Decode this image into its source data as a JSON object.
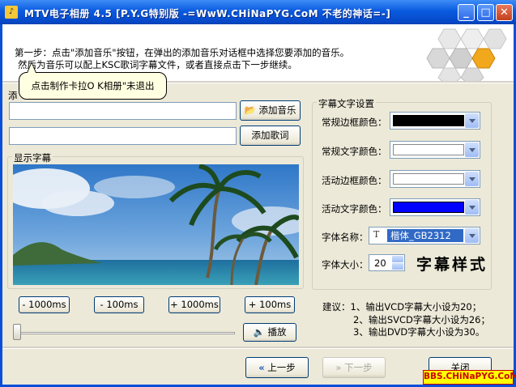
{
  "window": {
    "title": "MTV电子相册 4.5 [P.Y.G特别版 -=WwW.CHiNaPYG.CoM 不老的神话=-]",
    "title_icon": "app-icon",
    "controls": [
      "minimize-icon",
      "maximize-icon",
      "close-icon"
    ]
  },
  "header": {
    "step_line1": "第一步：点击\"添加音乐\"按钮，在弹出的添加音乐对话框中选择您要添加的音乐。",
    "step_line2": "然后为音乐可以配上KSC歌词字幕文件，或者直接点击下一步继续。"
  },
  "tooltip": {
    "text": "点击制作卡拉O K相册\"未退出"
  },
  "files": {
    "partial_label": "添",
    "music_value": "",
    "lyrics_value": "",
    "add_music_label": "添加音乐",
    "add_lyrics_label": "添加歌词"
  },
  "preview": {
    "group_title": "显示字幕"
  },
  "offset_buttons": [
    "- 1000ms",
    "- 100ms",
    "+ 1000ms",
    "+ 100ms"
  ],
  "player": {
    "play_label": "播放",
    "position": 0
  },
  "font_settings": {
    "group_title": "字幕文字设置",
    "normal_border_label": "常规边框颜色：",
    "normal_border_color": "#000000",
    "normal_text_label": "常规文字颜色：",
    "normal_text_color": "#ffffff",
    "active_border_label": "活动边框颜色：",
    "active_border_color": "#ffffff",
    "active_text_label": "活动文字颜色：",
    "active_text_color": "#0000ff",
    "font_name_label": "字体名称：",
    "font_name_value": "楷体_GB2312",
    "font_size_label": "字体大小：",
    "font_size_value": "20",
    "sample_text": "字幕样式"
  },
  "advice": {
    "line1": "建议：1、输出VCD字幕大小设为20；",
    "line2": "2、输出SVCD字幕大小设为26；",
    "line3": "3、输出DVD字幕大小设为30。"
  },
  "nav": {
    "prev_label": "上一步",
    "next_label": "下一步",
    "close_label": "关闭"
  },
  "watermark": {
    "text": "BBS.CHiNaPYG.CoM"
  }
}
